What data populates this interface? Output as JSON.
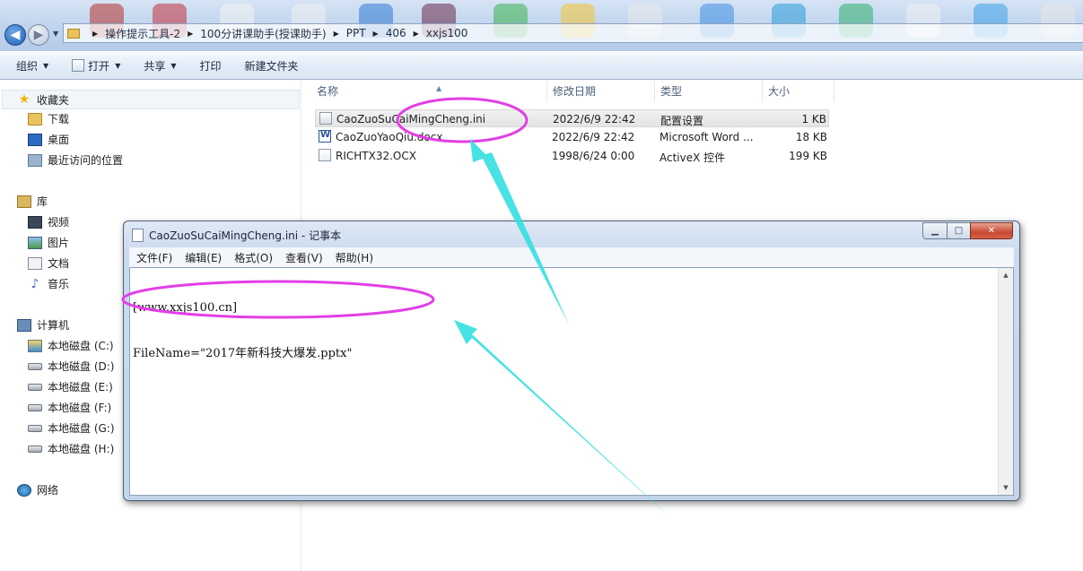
{
  "address_bar": {
    "back_glyph": "◀",
    "forward_glyph": "▶",
    "history_glyph": "▼",
    "breadcrumbs": [
      "操作提示工具-2",
      "100分讲课助手(授课助手)",
      "PPT",
      "406",
      "xxjs100"
    ],
    "separator": "▶"
  },
  "toolbar": {
    "organize": "组织",
    "open": "打开",
    "share": "共享",
    "print": "打印",
    "new_folder": "新建文件夹",
    "dropdown_glyph": "▼"
  },
  "sidebar": {
    "favorites": "收藏夹",
    "downloads": "下载",
    "desktop": "桌面",
    "recent": "最近访问的位置",
    "libraries": "库",
    "videos": "视频",
    "pictures": "图片",
    "documents": "文档",
    "music": "音乐",
    "computer": "计算机",
    "drives": [
      "本地磁盘 (C:)",
      "本地磁盘 (D:)",
      "本地磁盘 (E:)",
      "本地磁盘 (F:)",
      "本地磁盘 (G:)",
      "本地磁盘 (H:)"
    ],
    "network": "网络"
  },
  "file_list": {
    "columns": {
      "name": "名称",
      "modified": "修改日期",
      "type": "类型",
      "size": "大小"
    },
    "sort_glyph": "▲",
    "files": [
      {
        "name": "CaoZuoSuCaiMingCheng.ini",
        "modified": "2022/6/9 22:42",
        "type": "配置设置",
        "size": "1 KB"
      },
      {
        "name": "CaoZuoYaoQiu.docx",
        "modified": "2022/6/9 22:42",
        "type": "Microsoft Word ...",
        "size": "18 KB"
      },
      {
        "name": "RICHTX32.OCX",
        "modified": "1998/6/24 0:00",
        "type": "ActiveX 控件",
        "size": "199 KB"
      }
    ]
  },
  "notepad": {
    "title": "CaoZuoSuCaiMingCheng.ini - 记事本",
    "menus": [
      "文件(F)",
      "编辑(E)",
      "格式(O)",
      "查看(V)",
      "帮助(H)"
    ],
    "lines": [
      "[www.xxjs100.cn]",
      "FileName=\"2017年新科技大爆发.pptx\""
    ],
    "min_glyph": "▁",
    "max_glyph": "□",
    "close_glyph": "✕",
    "scroll_up": "▲",
    "scroll_down": "▼"
  },
  "colors": {
    "highlight_ellipse": "#e33ee6",
    "arrow": "#33dfe0"
  }
}
